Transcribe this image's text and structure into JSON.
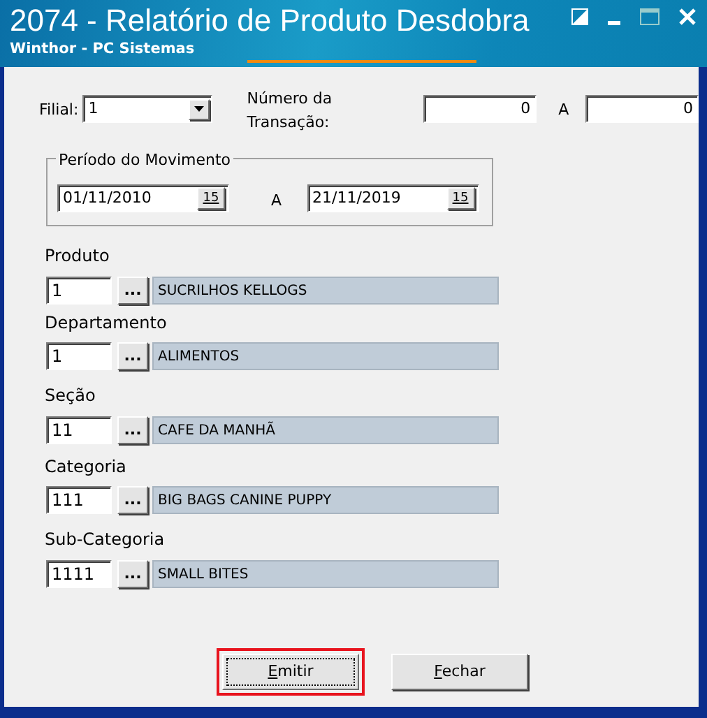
{
  "window": {
    "title": "2074 - Relatório de Produto Desdobra",
    "subtitle": "Winthor - PC Sistemas"
  },
  "filial": {
    "label": "Filial:",
    "value": "1"
  },
  "transacao": {
    "label": "Número da Transação:",
    "from": "0",
    "separator": "A",
    "to": "0"
  },
  "periodo": {
    "title": "Período do Movimento",
    "from": "01/11/2010",
    "from_button": "15",
    "separator": "A",
    "to": "21/11/2019",
    "to_button": "15"
  },
  "filters": [
    {
      "label": "Produto",
      "code": "1",
      "lookup": "...",
      "description": "SUCRILHOS KELLOGS"
    },
    {
      "label": "Departamento",
      "code": "1",
      "lookup": "...",
      "description": "ALIMENTOS"
    },
    {
      "label": "Seção",
      "code": "11",
      "lookup": "...",
      "description": "CAFE DA MANHÃ"
    },
    {
      "label": "Categoria",
      "code": "111",
      "lookup": "...",
      "description": "BIG BAGS CANINE PUPPY"
    },
    {
      "label": "Sub-Categoria",
      "code": "1111",
      "lookup": "...",
      "description": "SMALL BITES"
    }
  ],
  "buttons": [
    {
      "label": "Emitir",
      "focused": true,
      "highlighted": true
    },
    {
      "label": "Fechar",
      "focused": false,
      "highlighted": false
    }
  ]
}
